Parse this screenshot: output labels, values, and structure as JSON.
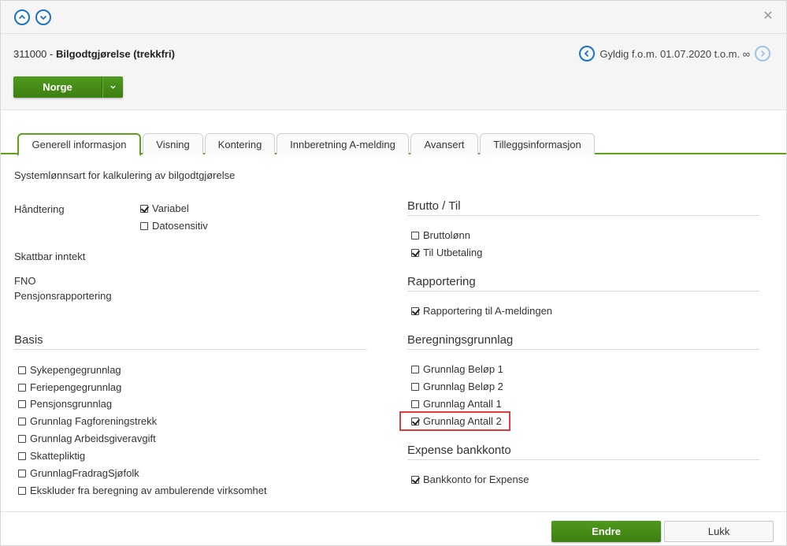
{
  "header": {
    "record_code": "311000 - ",
    "record_name": "Bilgodtgjørelse (trekkfri)",
    "validity": "Gyldig f.o.m. 01.07.2020 t.o.m. ∞"
  },
  "country_button": {
    "label": "Norge"
  },
  "tabs": [
    {
      "label": "Generell informasjon",
      "active": true
    },
    {
      "label": "Visning"
    },
    {
      "label": "Kontering"
    },
    {
      "label": "Innberetning A-melding"
    },
    {
      "label": "Avansert"
    },
    {
      "label": "Tilleggsinformasjon"
    }
  ],
  "general": {
    "description": "Systemlønnsart for kalkulering av bilgodtgjørelse",
    "handtering_label": "Håndtering",
    "handtering": [
      {
        "label": "Variabel",
        "checked": true
      },
      {
        "label": "Datosensitiv",
        "checked": false
      }
    ],
    "skattbar_label": "Skattbar inntekt",
    "fno_label": "FNO",
    "pensjon_label": "Pensjonsrapportering"
  },
  "basis": {
    "title": "Basis",
    "items": [
      {
        "label": "Sykepengegrunnlag",
        "checked": false
      },
      {
        "label": "Feriepengegrunnlag",
        "checked": false
      },
      {
        "label": "Pensjonsgrunnlag",
        "checked": false
      },
      {
        "label": "Grunnlag Fagforeningstrekk",
        "checked": false
      },
      {
        "label": "Grunnlag Arbeidsgiveravgift",
        "checked": false
      },
      {
        "label": "Skattepliktig",
        "checked": false
      },
      {
        "label": "GrunnlagFradragSjøfolk",
        "checked": false
      },
      {
        "label": "Ekskluder fra beregning av ambulerende virksomhet",
        "checked": false
      }
    ]
  },
  "brutto": {
    "title": "Brutto / Til",
    "items": [
      {
        "label": "Bruttolønn",
        "checked": false
      },
      {
        "label": "Til Utbetaling",
        "checked": true
      }
    ]
  },
  "rapportering": {
    "title": "Rapportering",
    "items": [
      {
        "label": "Rapportering til A-meldingen",
        "checked": true
      }
    ]
  },
  "beregning": {
    "title": "Beregningsgrunnlag",
    "items": [
      {
        "label": "Grunnlag Beløp 1",
        "checked": false
      },
      {
        "label": "Grunnlag Beløp 2",
        "checked": false
      },
      {
        "label": "Grunnlag Antall 1",
        "checked": false
      },
      {
        "label": "Grunnlag Antall 2",
        "checked": true
      }
    ]
  },
  "expense": {
    "title": "Expense bankkonto",
    "items": [
      {
        "label": "Bankkonto for Expense",
        "checked": true
      }
    ]
  },
  "footer": {
    "edit_label": "Endre",
    "close_label": "Lukk"
  },
  "colors": {
    "accent_green": "#4f9a1e",
    "link_blue": "#1a73c9",
    "highlight_red": "#e33b3b"
  }
}
